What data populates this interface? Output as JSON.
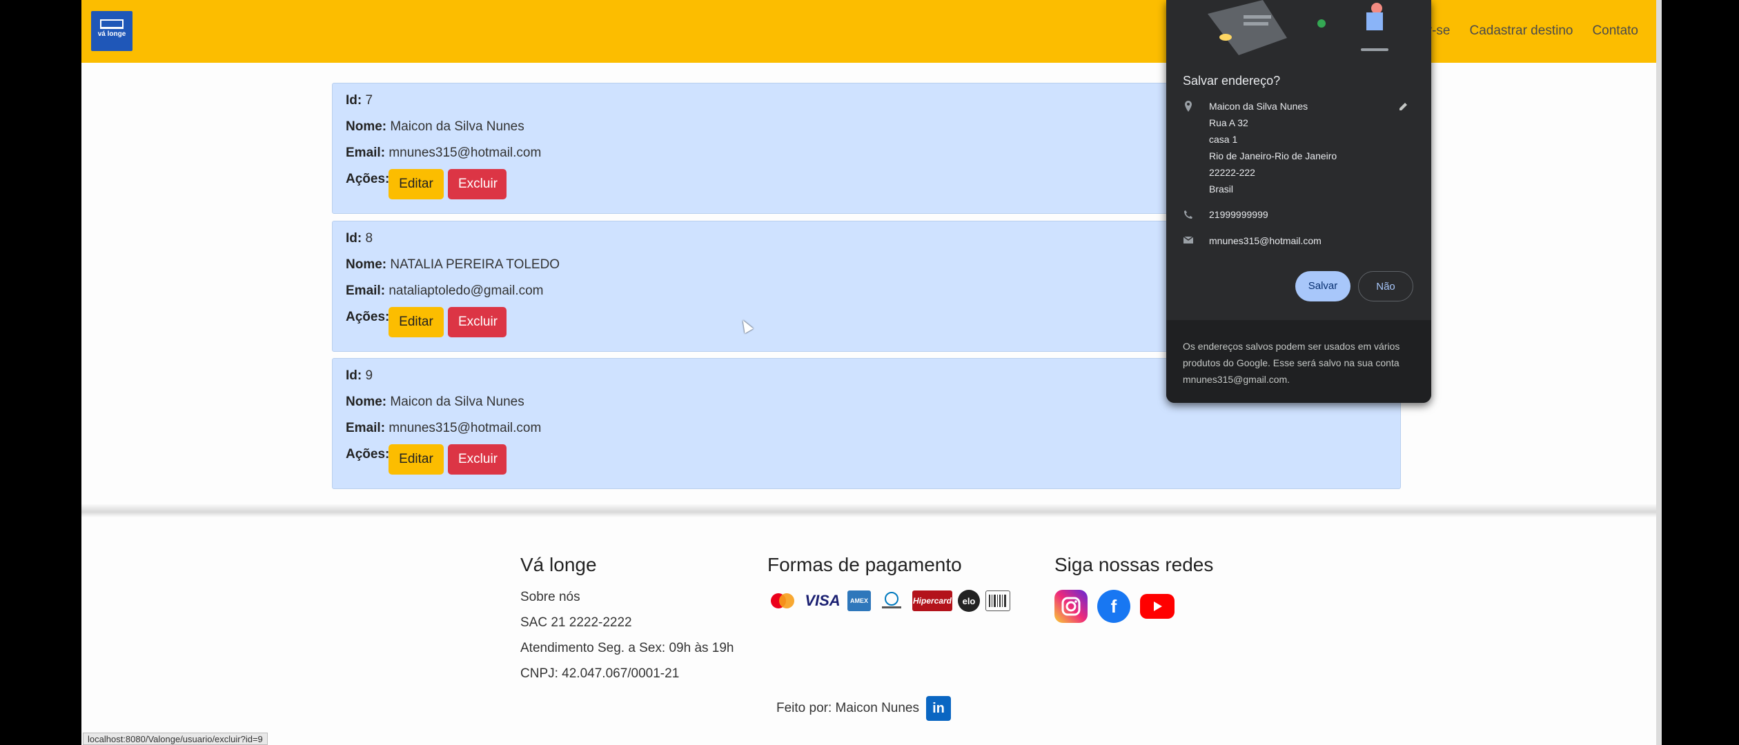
{
  "navbar": {
    "logo_text": "vá longe",
    "links": [
      "ar-se",
      "Cadastrar destino",
      "Contato"
    ]
  },
  "users": [
    {
      "id": "7",
      "nome": "Maicon da Silva Nunes",
      "email": "mnunes315@hotmail.com"
    },
    {
      "id": "8",
      "nome": "NATALIA PEREIRA TOLEDO",
      "email": "nataliaptoledo@gmail.com"
    },
    {
      "id": "9",
      "nome": "Maicon da Silva Nunes",
      "email": "mnunes315@hotmail.com"
    }
  ],
  "labels": {
    "id": "Id:",
    "nome": "Nome:",
    "email": "Email:",
    "acoes": "Ações:",
    "editar": "Editar",
    "excluir": "Excluir"
  },
  "footer": {
    "col1": {
      "title": "Vá longe",
      "lines": [
        "Sobre nós",
        "SAC 21 2222-2222",
        "Atendimento Seg. a Sex: 09h às 19h",
        "CNPJ: 42.047.067/0001-21"
      ]
    },
    "col2": {
      "title": "Formas de pagamento",
      "methods": [
        "Mastercard",
        "VISA",
        "Amex",
        "Diners",
        "Hipercard",
        "elo",
        "Boleto"
      ]
    },
    "col3": {
      "title": "Siga nossas redes",
      "networks": [
        "instagram-icon",
        "facebook-icon",
        "youtube-icon"
      ]
    },
    "credit": "Feito por: Maicon Nunes"
  },
  "status_url": "localhost:8080/Valonge/usuario/excluir?id=9",
  "popup": {
    "title": "Salvar endereço?",
    "address_lines": [
      "Maicon da Silva Nunes",
      "Rua A 32",
      "casa 1",
      "Rio de Janeiro-Rio de Janeiro",
      "22222-222",
      "Brasil"
    ],
    "phone": "21999999999",
    "email": "mnunes315@hotmail.com",
    "save_label": "Salvar",
    "no_label": "Não",
    "footer_text": "Os endereços salvos podem ser usados em vários produtos do Google. Esse será salvo na sua conta mnunes315@gmail.com."
  },
  "colors": {
    "navbar": "#fcbd00",
    "card": "#cfe2ff",
    "edit": "#fcbd00",
    "delete": "#dc3545",
    "popup": "#2a2b2d"
  }
}
